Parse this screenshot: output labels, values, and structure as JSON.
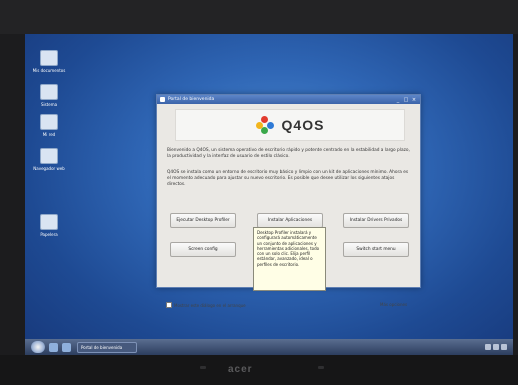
{
  "desktop": {
    "icons": [
      {
        "label": "Mis documentos",
        "icon": "folder-documents-icon"
      },
      {
        "label": "Sistema",
        "icon": "computer-icon"
      },
      {
        "label": "Mi red",
        "icon": "network-icon"
      },
      {
        "label": "Navegador web",
        "icon": "browser-icon"
      },
      {
        "label": "Papelera",
        "icon": "trash-icon"
      }
    ]
  },
  "window": {
    "title": "Portal de bienvenida",
    "controls": [
      "_",
      "□",
      "×"
    ],
    "logo_text": "Q4OS",
    "intro": "Bienvenido a Q4OS, un sistema operativo de escritorio rápido y potente centrado en la estabilidad a largo plazo, la productividad y la interfaz de usuario de estilo clásico.",
    "intro2": "Q4OS se instala como un entorno de escritorio muy básico y limpio con un kit de aplicaciones mínimo. Ahora es el momento adecuado para ajustar su nuevo escritorio. Es posible que desee utilizar los siguientes atajos directos.",
    "buttons": {
      "desktop_profiler": "Ejecutar Desktop Profiler",
      "install_apps": "Instalar Aplicaciones",
      "install_drivers": "Instalar Drivers Privados",
      "screen_config": "Screen config",
      "switch_start": "Switch start menu"
    },
    "tooltip": "Desktop Profiler instalará y configurará automáticamente un conjunto de aplicaciones y herramientas adicionales, todo con un solo clic. Elija perfil estándar, avanzado, ideal o perfiles de escritorio.",
    "checkbox_label": "Mostrar este diálogo en el arranque",
    "link_label": "Más opciones"
  },
  "taskbar": {
    "task_label": "Portal de bienvenida"
  },
  "bezel": {
    "brand": "acer"
  },
  "colors": {
    "desktop_bg": "#2f66b5",
    "titlebar": "#4a73b8",
    "window_bg": "#eae8e4"
  }
}
